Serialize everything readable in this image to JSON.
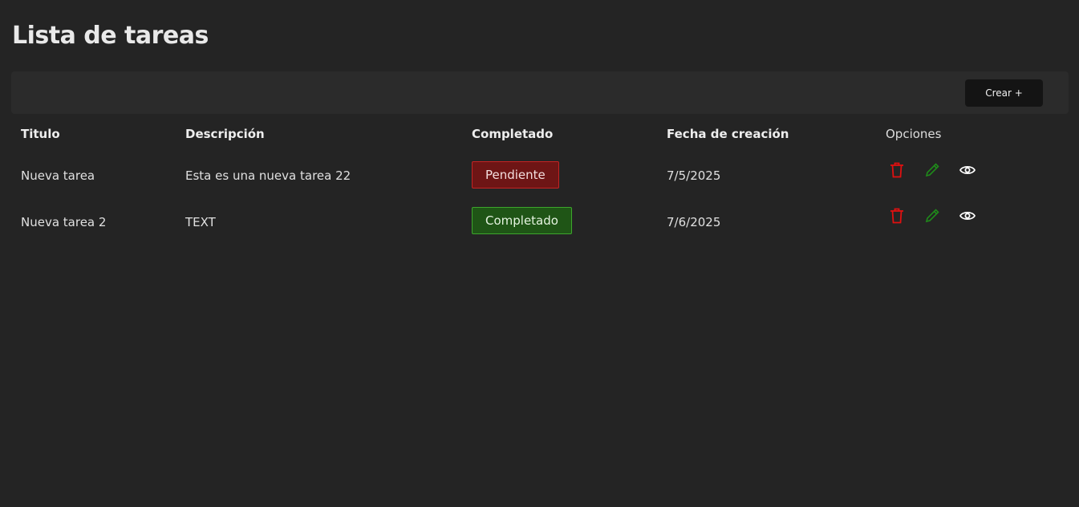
{
  "page": {
    "title": "Lista de tareas"
  },
  "toolbar": {
    "create_label": "Crear +"
  },
  "table": {
    "headers": {
      "title": "Titulo",
      "description": "Descripción",
      "completed": "Completado",
      "created": "Fecha de creación",
      "options": "Opciones"
    },
    "rows": [
      {
        "title": "Nueva tarea",
        "description": "Esta es una nueva tarea 22",
        "status": "Pendiente",
        "status_type": "pending",
        "date": "7/5/2025"
      },
      {
        "title": "Nueva tarea 2",
        "description": "TEXT",
        "status": "Completado",
        "status_type": "done",
        "date": "7/6/2025"
      }
    ]
  },
  "icons": {
    "delete": "trash-icon",
    "edit": "pencil-icon",
    "view": "eye-icon"
  },
  "colors": {
    "background": "#242424",
    "toolbar": "#2b2b2b",
    "button": "#141414",
    "delete": "#e01010",
    "edit": "#1f8a1a",
    "view": "#ffffff",
    "pending_bg": "#6e1515",
    "done_bg": "#1f5516"
  }
}
